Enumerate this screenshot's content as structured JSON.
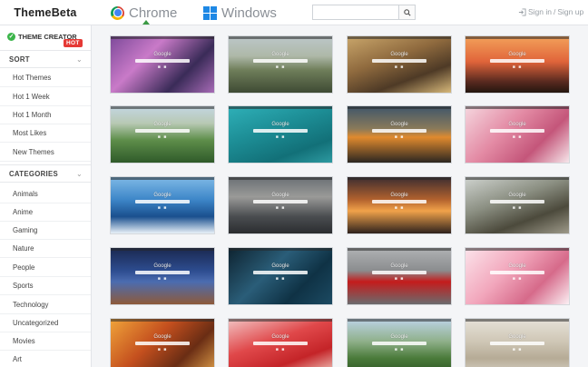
{
  "header": {
    "logo": "ThemeBeta",
    "tabs": [
      {
        "label": "Chrome",
        "active": true
      },
      {
        "label": "Windows",
        "active": false
      }
    ],
    "search_placeholder": "",
    "sign_in": "Sign in",
    "separator": "/",
    "sign_up": "Sign up"
  },
  "sidebar": {
    "creator_label": "THEME CREATOR",
    "hot_badge": "HOT",
    "sort_heading": "SORT",
    "sort_items": [
      "Hot Themes",
      "Hot 1 Week",
      "Hot 1 Month",
      "Most Likes",
      "New Themes"
    ],
    "categories_heading": "CATEGORIES",
    "category_items": [
      "Animals",
      "Anime",
      "Gaming",
      "Nature",
      "People",
      "Sports",
      "Technology",
      "Uncategorized",
      "Movies",
      "Art"
    ]
  },
  "tiles": [
    {
      "label": "Google",
      "bg": "linear-gradient(135deg,#7d4a9a 0%,#c97ac8 35%,#3a2b58 70%,#a76bb6 100%)"
    },
    {
      "label": "Google",
      "bg": "linear-gradient(180deg,#bcc7c9 0%,#aeb8a8 35%,#6f7e5a 60%,#3e4a34 100%)"
    },
    {
      "label": "Google",
      "bg": "linear-gradient(160deg,#c9a66b 0%,#8f6a3e 40%,#4e3a26 70%,#d7b87a 100%)"
    },
    {
      "label": "Google",
      "bg": "linear-gradient(180deg,#f3a15a 0%,#e0643a 45%,#5a2a20 80%,#24160f 100%)"
    },
    {
      "label": "Google",
      "bg": "linear-gradient(180deg,#c3d6e2 0%,#b8c9b4 30%,#5e8e4a 60%,#2f5a2a 100%)"
    },
    {
      "label": "Google",
      "bg": "linear-gradient(160deg,#2fb0b8 0%,#1d8e96 40%,#127078 75%,#2d9aa1 100%)"
    },
    {
      "label": "Google",
      "bg": "linear-gradient(180deg,#40566a 0%,#8a7a5a 40%,#e08a2e 55%,#2b2621 100%)"
    },
    {
      "label": "Google",
      "bg": "linear-gradient(135deg,#f5d6de 0%,#e38aa4 40%,#c4567a 70%,#f6e6ea 100%)"
    },
    {
      "label": "Google",
      "bg": "linear-gradient(180deg,#7fb9e6 0%,#3d86c8 40%,#1a4f8e 70%,#e9f1f8 100%)"
    },
    {
      "label": "Google",
      "bg": "linear-gradient(180deg,#6a6f74 0%,#9a9a98 35%,#4a4d50 70%,#2b2d30 100%)"
    },
    {
      "label": "Google",
      "bg": "linear-gradient(180deg,#3c2d30 0%,#b2622e 40%,#f0a24a 60%,#2e221d 100%)"
    },
    {
      "label": "Google",
      "bg": "linear-gradient(160deg,#cfd3cf 0%,#8b8f82 40%,#4c4a3c 70%,#9e9a8a 100%)"
    },
    {
      "label": "Google",
      "bg": "linear-gradient(180deg,#1a2850 0%,#2d4c8f 40%,#4b6cb0 60%,#8e5a3a 100%)"
    },
    {
      "label": "Google",
      "bg": "linear-gradient(135deg,#0e2330 0%,#2a5d78 40%,#0f3245 70%,#1c4a62 100%)"
    },
    {
      "label": "Google",
      "bg": "linear-gradient(180deg,#b0b2b4 0%,#8b8d8f 40%,#c41c1c 60%,#6a6c6e 100%)"
    },
    {
      "label": "Google",
      "bg": "linear-gradient(135deg,#fbe3ea 0%,#f2a7bc 40%,#d66a8a 70%,#fbeff3 100%)"
    },
    {
      "label": "Google",
      "bg": "linear-gradient(135deg,#f0a43a 0%,#c44f1e 40%,#6a2d14 70%,#e0a04a 100%)"
    },
    {
      "label": "Google",
      "bg": "linear-gradient(160deg,#f2c4c4 0%,#e0484a 40%,#c42428 70%,#f4d3c8 100%)"
    },
    {
      "label": "Google",
      "bg": "linear-gradient(180deg,#bcd3e6 0%,#8fb08a 40%,#4a7a3a 70%,#2d5424 100%)"
    },
    {
      "label": "Google",
      "bg": "linear-gradient(180deg,#e6e1d8 0%,#cfc7b6 40%,#b6ab96 70%,#d8d2c6 100%)"
    }
  ]
}
